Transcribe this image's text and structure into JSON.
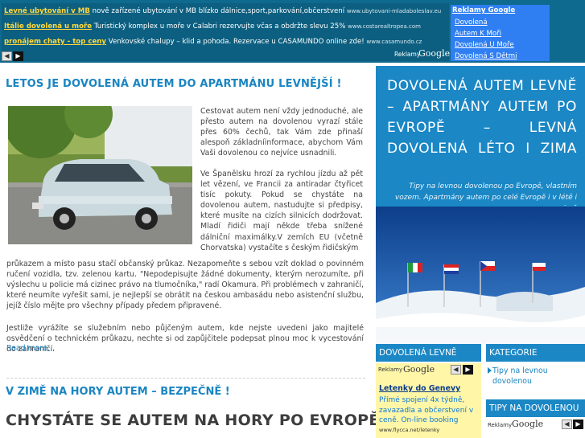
{
  "top_ads": [
    {
      "title": "Levné ubytování v MB",
      "text": " nově zařízené ubytování v MB blízko dálnice,sport,parkování,občerstvení ",
      "url": "www.ubytovani-mladaboleslav.eu"
    },
    {
      "title": "Itálie dovolená u moře",
      "text": " Turistický komplex u moře v Calabri rezervujte včas a obdržte slevu 25% ",
      "url": "www.costarealtropea.com"
    },
    {
      "title": "pronájem chaty - top ceny",
      "text": " Venkovské chalupy – klid a pohoda. Rezervace u CASAMUNDO online zde! ",
      "url": "www.casamundo.cz"
    }
  ],
  "ads_label": "Reklamy",
  "ads_brand": "Google",
  "google_ads_heading": "Reklamy Google",
  "google_ads_links": [
    "Dovolená",
    "Autem K Moři",
    "Dovolená U Moře",
    "Dovolená S Dětmi"
  ],
  "article": {
    "title": "LETOS JE DOVOLENÁ AUTEM DO APARTMÁNU LEVNĚJŠÍ !",
    "p1": "Cestovat autem není vždy jednoduché, ale přesto autem na dovolenou vyrazí stále přes 60% čechů, tak Vám zde přinaší alespoň základníinformace, abychom Vám Vaši dovolenou co nejvíce usnadnili.",
    "p2_side": "Ve Španělsku hrozí za rychlou jízdu až pět let vězení, ve Francii za antiradar čtyřicet tisíc pokuty. Pokud se chystáte na dovolenou autem, nastudujte si předpisy, které musíte na cizích silnicích dodržovat. Mladí řidiči mají někde třeba snížené dálniční maximálky.V zemích EU (včetně Chorvatska) vystačíte s českým řidičským",
    "p2_full": "průkazem a místo pasu stačí občanský průkaz. Nezapomeňte s sebou vzít doklad o povinném ručení vozidla, tzv. zelenou kartu. \"Nepodepisujte žádné dokumenty, kterým nerozumíte, při výslechu u policie má cizinec právo na tlumočníka,\" radí Okamura. Při problémech v zahraničí, které neumíte vyřešit sami, je nejlepší se obrátit na českou ambasádu nebo asistenční službu, jejíž číslo mějte pro všechny případy předem připravené.",
    "p3": "Jestliže vyrážíte se služebním nebo půjčeným autem, kde nejste uvedeni jako majitelé osvědčení o technickém průkazu, nechte si od zapůjčitele podepsat plnou moc k vycestování do zahraničí.",
    "read_more": "Read more…"
  },
  "article2_title": "V ZIMĚ NA HORY AUTEM – BEZPEČNĚ !",
  "article3_title": "CHYSTÁTE SE AUTEM NA HORY PO EVROPĚ",
  "hero": {
    "title": "DOVOLENÁ AUTEM LEVNĚ – APARTMÁNY AUTEM PO EVROPĚ – LEVNÁ DOVOLENÁ LÉTO I ZIMA",
    "subtitle": "Tipy na levnou dovolenou po Evropě, vlastním vozem. Apartmány autem po celé Evropě i v létě i zimě"
  },
  "widgets": {
    "dovolena_levne": "DOVOLENÁ LEVNĚ",
    "kategorie": "KATEGORIE",
    "kategorie_item": "Tipy na levnou dovolenou",
    "tipy": "TIPY NA DOVOLENOU"
  },
  "ad2": {
    "title": "Letenky do Genevy",
    "text": "Přímé spojení 4x týdně, zavazadla a občerstvení v ceně. On-line booking",
    "url": "www.flycca.net/letenky"
  },
  "colors": {
    "accent": "#1b87c5",
    "banner": "#0e6a8e",
    "ad_yellow": "#fff6a8",
    "link_yellow": "#ffd93d"
  }
}
